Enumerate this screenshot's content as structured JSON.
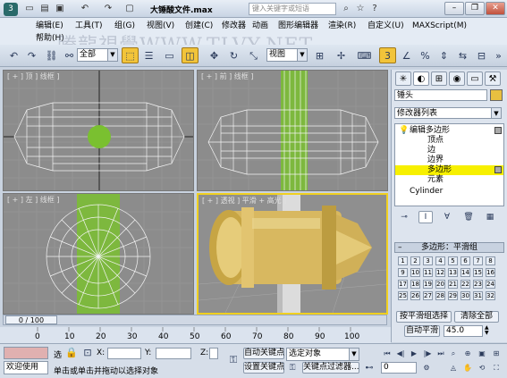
{
  "title": {
    "document": "大锤酸文件.max",
    "search_placeholder": "键入关键字或短语"
  },
  "watermark": "腾龍視覺WWW.TLVY.NET",
  "menu": [
    "编辑(E)",
    "工具(T)",
    "组(G)",
    "视图(V)",
    "创建(C)",
    "修改器",
    "动画",
    "图形编辑器",
    "渲染(R)",
    "自定义(U)",
    "MAXScript(M)",
    "帮助(H)"
  ],
  "toolbar": {
    "selection_filter": "全部",
    "reference_coord": "视图",
    "snap_value": "3"
  },
  "viewports": [
    {
      "label": "[ + ] 顶 ] 线框 ]"
    },
    {
      "label": "[ + ] 前 ] 线框 ]"
    },
    {
      "label": "[ + ] 左 ] 线框 ]"
    },
    {
      "label": "[ + ] 透视 ] 平滑 + 高光 ]"
    }
  ],
  "panel": {
    "object_name": "锤头",
    "modifier_list": "修改器列表",
    "stack": [
      {
        "label": "编辑多边形"
      },
      {
        "label": "顶点"
      },
      {
        "label": "边"
      },
      {
        "label": "边界"
      },
      {
        "label": "多边形"
      },
      {
        "label": "元素"
      },
      {
        "label": "Cylinder"
      }
    ],
    "rollout_title": "多边形：平滑组",
    "smoothing_groups": [
      "1",
      "2",
      "3",
      "4",
      "5",
      "6",
      "7",
      "8",
      "9",
      "10",
      "11",
      "12",
      "13",
      "14",
      "15",
      "16",
      "17",
      "18",
      "19",
      "20",
      "21",
      "22",
      "23",
      "24",
      "25",
      "26",
      "27",
      "28",
      "29",
      "30",
      "31",
      "32"
    ],
    "select_by_sg": "按平滑组选择",
    "clear_all": "清除全部",
    "auto_smooth": "自动平滑",
    "auto_smooth_value": "45.0"
  },
  "timeline": {
    "counter": "0 / 100",
    "ticks": [
      "0",
      "10",
      "20",
      "30",
      "40",
      "50",
      "60",
      "70",
      "80",
      "90",
      "100"
    ]
  },
  "status": {
    "welcome": "欢迎使用",
    "selected_label": "选",
    "x_label": "X:",
    "y_label": "Y:",
    "z_label": "Z:",
    "grid_hint": "单击或单击并拖动以选择对象",
    "auto_key": "自动关键点",
    "set_key": "设置关键点",
    "key_mode": "选定对象",
    "key_filters": "关键点过滤器...",
    "frame": "0"
  },
  "colors": {
    "selection_green": "#7ac030",
    "hammer_gold": "#d8b860",
    "active_tool": "#f2c43a",
    "stack_highlight": "#f7f000"
  }
}
